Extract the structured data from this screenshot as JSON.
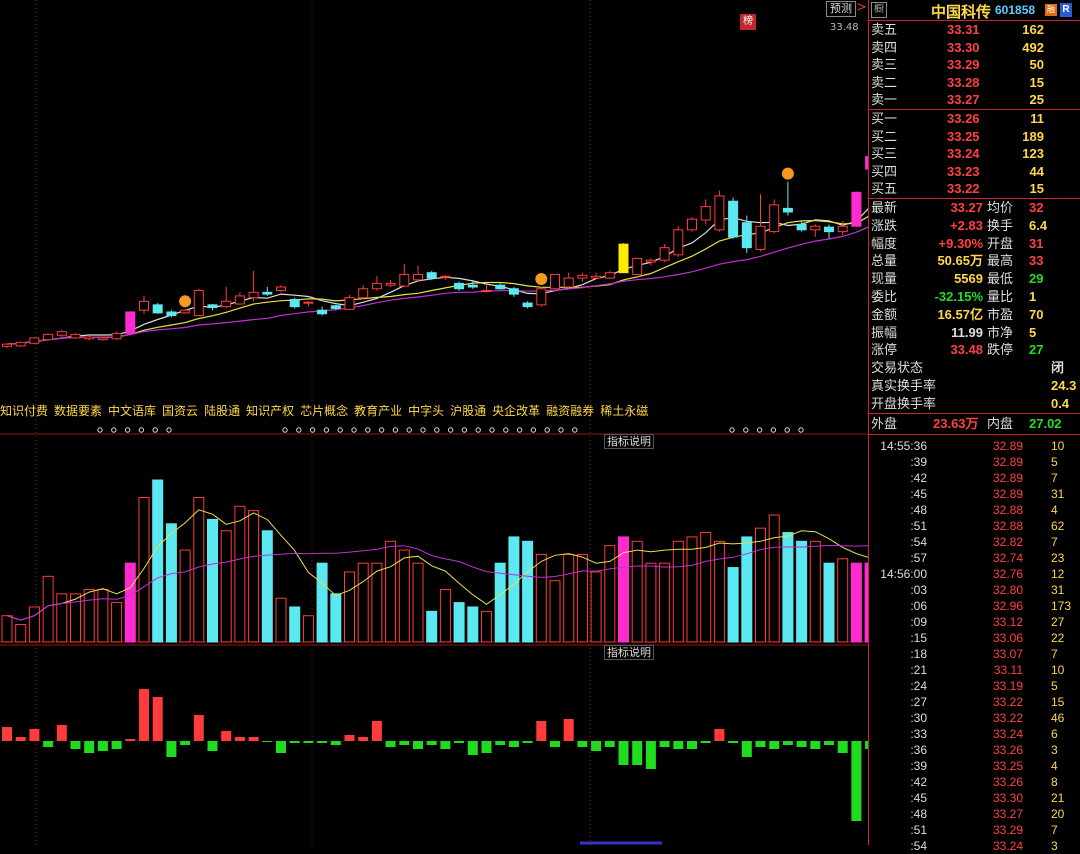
{
  "panel": {
    "stock_name": "中国科传",
    "stock_code": "601858",
    "icon_label": "橱",
    "badge_rong": "融",
    "badge_r": "R",
    "order_book": {
      "sells": [
        {
          "label": "卖五",
          "price": "33.31",
          "vol": "162"
        },
        {
          "label": "卖四",
          "price": "33.30",
          "vol": "492"
        },
        {
          "label": "卖三",
          "price": "33.29",
          "vol": "50"
        },
        {
          "label": "卖二",
          "price": "33.28",
          "vol": "15"
        },
        {
          "label": "卖一",
          "price": "33.27",
          "vol": "25"
        }
      ],
      "buys": [
        {
          "label": "买一",
          "price": "33.26",
          "vol": "11"
        },
        {
          "label": "买二",
          "price": "33.25",
          "vol": "189"
        },
        {
          "label": "买三",
          "price": "33.24",
          "vol": "123"
        },
        {
          "label": "买四",
          "price": "33.23",
          "vol": "44"
        },
        {
          "label": "买五",
          "price": "33.22",
          "vol": "15"
        }
      ]
    },
    "quote": [
      {
        "l1": "最新",
        "v1": "33.27",
        "c1": "red",
        "l2": "均价",
        "v2": "32",
        "c2": "red"
      },
      {
        "l1": "涨跌",
        "v1": "+2.83",
        "c1": "red",
        "l2": "换手",
        "v2": "6.4",
        "c2": "yel"
      },
      {
        "l1": "幅度",
        "v1": "+9.30%",
        "c1": "red",
        "l2": "开盘",
        "v2": "31",
        "c2": "red"
      },
      {
        "l1": "总量",
        "v1": "50.65万",
        "c1": "yel",
        "l2": "最高",
        "v2": "33",
        "c2": "red"
      },
      {
        "l1": "现量",
        "v1": "5569",
        "c1": "yel",
        "l2": "最低",
        "v2": "29",
        "c2": "grn"
      },
      {
        "l1": "委比",
        "v1": "-32.15%",
        "c1": "grn",
        "l2": "量比",
        "v2": "1",
        "c2": "yel"
      },
      {
        "l1": "金额",
        "v1": "16.57亿",
        "c1": "yel",
        "l2": "市盈",
        "v2": "70",
        "c2": "yel"
      },
      {
        "l1": "振幅",
        "v1": "11.99",
        "c1": "wht",
        "l2": "市净",
        "v2": "5",
        "c2": "yel"
      },
      {
        "l1": "涨停",
        "v1": "33.48",
        "c1": "red",
        "l2": "跌停",
        "v2": "27",
        "c2": "grn"
      }
    ],
    "extra": [
      {
        "label": "交易状态",
        "value": "闭",
        "c": "wht"
      },
      {
        "label": "真实换手率",
        "value": "24.3",
        "c": "yel"
      },
      {
        "label": "开盘换手率",
        "value": "0.4",
        "c": "yel"
      }
    ],
    "waipan_label": "外盘",
    "waipan": "23.63万",
    "neipan_label": "内盘",
    "neipan": "27.02",
    "ticks": [
      {
        "t": "14:55:36",
        "p": "32.89",
        "v": "10"
      },
      {
        "t": ":39",
        "p": "32.89",
        "v": "5"
      },
      {
        "t": ":42",
        "p": "32.89",
        "v": "7"
      },
      {
        "t": ":45",
        "p": "32.89",
        "v": "31"
      },
      {
        "t": ":48",
        "p": "32.88",
        "v": "4"
      },
      {
        "t": ":51",
        "p": "32.88",
        "v": "62"
      },
      {
        "t": ":54",
        "p": "32.82",
        "v": "7"
      },
      {
        "t": ":57",
        "p": "32.74",
        "v": "23"
      },
      {
        "t": "14:56:00",
        "p": "32.76",
        "v": "12"
      },
      {
        "t": ":03",
        "p": "32.80",
        "v": "31"
      },
      {
        "t": ":06",
        "p": "32.96",
        "v": "173"
      },
      {
        "t": ":09",
        "p": "33.12",
        "v": "27"
      },
      {
        "t": ":15",
        "p": "33.06",
        "v": "22"
      },
      {
        "t": ":18",
        "p": "33.07",
        "v": "7"
      },
      {
        "t": ":21",
        "p": "33.11",
        "v": "10"
      },
      {
        "t": ":24",
        "p": "33.19",
        "v": "5"
      },
      {
        "t": ":27",
        "p": "33.22",
        "v": "15"
      },
      {
        "t": ":30",
        "p": "33.22",
        "v": "46"
      },
      {
        "t": ":33",
        "p": "33.24",
        "v": "6"
      },
      {
        "t": ":36",
        "p": "33.26",
        "v": "3"
      },
      {
        "t": ":39",
        "p": "33.25",
        "v": "4"
      },
      {
        "t": ":42",
        "p": "33.26",
        "v": "8"
      },
      {
        "t": ":45",
        "p": "33.30",
        "v": "21"
      },
      {
        "t": ":48",
        "p": "33.27",
        "v": "20"
      },
      {
        "t": ":51",
        "p": "33.29",
        "v": "7"
      },
      {
        "t": ":54",
        "p": "33.24",
        "v": "3"
      }
    ]
  },
  "chart": {
    "predict_button": "预测",
    "high_label": "33.48",
    "bang_label": "榜",
    "indicator_label_1": "指标说明",
    "indicator_label_2": "指标说明",
    "concept_tags": [
      "知识付费",
      "数据要素",
      "中文语库",
      "国资云",
      "陆股通",
      "知识产权",
      "芯片概念",
      "教育产业",
      "中字头",
      "沪股通",
      "央企改革",
      "融资融券",
      "稀土永磁"
    ]
  },
  "colors": {
    "up": "#ff3b3b",
    "down": "#5ce8f0",
    "magenta": "#ff2bd0",
    "limit": "#ffea00",
    "grid": "#8b1a1a",
    "ma5": "#dddddd",
    "ma10": "#e8e04a",
    "ma20": "#c030d0"
  },
  "chart_data": {
    "type": "candlestick",
    "ylim": [
      15.2,
      33.9
    ],
    "candles": [
      [
        16.08,
        16.2,
        15.98,
        16.25
      ],
      [
        16.1,
        16.3,
        16.05,
        16.35
      ],
      [
        16.25,
        16.55,
        16.2,
        16.6
      ],
      [
        16.45,
        16.75,
        16.4,
        16.8
      ],
      [
        16.7,
        16.9,
        16.6,
        17.0
      ],
      [
        16.55,
        16.75,
        16.5,
        16.8
      ],
      [
        16.5,
        16.6,
        16.4,
        16.7
      ],
      [
        16.45,
        16.55,
        16.4,
        16.6
      ],
      [
        16.5,
        16.8,
        16.45,
        16.9
      ],
      [
        16.8,
        18.0,
        16.75,
        18.05
      ],
      [
        18.1,
        18.6,
        17.9,
        18.9
      ],
      [
        18.4,
        17.95,
        17.9,
        18.5
      ],
      [
        18.0,
        17.8,
        17.7,
        18.1
      ],
      [
        17.95,
        18.1,
        17.9,
        18.15
      ],
      [
        17.8,
        19.2,
        17.8,
        19.3
      ],
      [
        18.4,
        18.25,
        18.1,
        18.45
      ],
      [
        18.3,
        18.6,
        18.2,
        19.4
      ],
      [
        18.45,
        18.9,
        18.4,
        19.1
      ],
      [
        18.8,
        19.1,
        18.6,
        20.3
      ],
      [
        19.1,
        19.0,
        18.9,
        19.4
      ],
      [
        19.2,
        19.4,
        19.1,
        19.5
      ],
      [
        18.7,
        18.3,
        18.2,
        18.8
      ],
      [
        18.5,
        18.55,
        18.3,
        18.6
      ],
      [
        18.1,
        17.9,
        17.8,
        18.3
      ],
      [
        18.35,
        18.2,
        18.1,
        18.4
      ],
      [
        18.15,
        18.8,
        18.1,
        18.95
      ],
      [
        18.8,
        19.3,
        18.7,
        19.5
      ],
      [
        19.3,
        19.6,
        19.2,
        20.0
      ],
      [
        19.5,
        19.6,
        19.4,
        19.8
      ],
      [
        19.45,
        20.1,
        19.4,
        20.7
      ],
      [
        19.8,
        20.1,
        19.7,
        20.6
      ],
      [
        20.2,
        19.9,
        19.8,
        20.3
      ],
      [
        19.95,
        20.0,
        19.8,
        20.05
      ],
      [
        19.6,
        19.3,
        19.2,
        19.7
      ],
      [
        19.5,
        19.4,
        19.3,
        19.8
      ],
      [
        19.2,
        19.2,
        19.1,
        19.5
      ],
      [
        19.5,
        19.3,
        19.25,
        19.6
      ],
      [
        19.3,
        19.0,
        18.85,
        19.4
      ],
      [
        18.5,
        18.3,
        18.2,
        18.6
      ],
      [
        18.4,
        19.3,
        18.3,
        19.4
      ],
      [
        19.3,
        20.1,
        19.3,
        20.1
      ],
      [
        19.4,
        19.9,
        19.3,
        20.2
      ],
      [
        19.9,
        20.05,
        19.7,
        20.2
      ],
      [
        19.9,
        20.0,
        19.85,
        20.2
      ],
      [
        19.9,
        20.2,
        19.85,
        20.3
      ],
      [
        20.2,
        21.8,
        20.2,
        21.85
      ],
      [
        20.1,
        21.0,
        20.1,
        21.0
      ],
      [
        20.8,
        20.9,
        20.6,
        21.0
      ],
      [
        20.9,
        21.6,
        20.8,
        21.8
      ],
      [
        21.2,
        22.6,
        21.1,
        22.8
      ],
      [
        22.6,
        23.2,
        22.5,
        23.3
      ],
      [
        23.15,
        23.9,
        22.9,
        24.3
      ],
      [
        22.6,
        24.5,
        22.5,
        24.8
      ],
      [
        24.2,
        22.2,
        22.1,
        24.4
      ],
      [
        23.0,
        21.6,
        21.3,
        23.4
      ],
      [
        21.5,
        22.8,
        21.4,
        24.6
      ],
      [
        22.5,
        24.0,
        22.4,
        24.3
      ],
      [
        23.8,
        23.6,
        23.4,
        25.3
      ],
      [
        22.9,
        22.6,
        22.5,
        23.1
      ],
      [
        22.6,
        22.8,
        22.2,
        22.9
      ],
      [
        22.75,
        22.5,
        22.1,
        22.9
      ],
      [
        22.5,
        22.8,
        22.3,
        23.1
      ],
      [
        22.8,
        24.7,
        22.8,
        24.75
      ],
      [
        26.0,
        26.7,
        25.8,
        27.0
      ],
      [
        25.8,
        26.3,
        25.6,
        28.0
      ],
      [
        26.4,
        28.6,
        26.4,
        28.65
      ],
      [
        28.2,
        30.1,
        27.0,
        30.2
      ],
      [
        29.4,
        29.9,
        28.3,
        30.0
      ],
      [
        29.2,
        29.8,
        28.0,
        30.2
      ],
      [
        29.1,
        29.2,
        28.0,
        29.6
      ],
      [
        29.3,
        29.6,
        28.6,
        30.0
      ],
      [
        28.9,
        30.3,
        28.5,
        31.6
      ],
      [
        30.5,
        32.1,
        30.4,
        32.15
      ],
      [
        30.6,
        33.27,
        29.9,
        33.48
      ]
    ],
    "limit_up_index": [
      9,
      45,
      62,
      63,
      64,
      66,
      71,
      72
    ],
    "volume": [
      30,
      20,
      40,
      75,
      55,
      55,
      60,
      60,
      45,
      90,
      165,
      185,
      135,
      105,
      165,
      140,
      127,
      155,
      150,
      127,
      50,
      40,
      30,
      90,
      55,
      80,
      90,
      90,
      115,
      105,
      90,
      35,
      60,
      45,
      40,
      35,
      90,
      120,
      115,
      100,
      70,
      100,
      100,
      80,
      110,
      120,
      115,
      90,
      90,
      115,
      120,
      125,
      115,
      85,
      120,
      130,
      145,
      125,
      115,
      115,
      90,
      95,
      90,
      90,
      100,
      155,
      115,
      110,
      125,
      140,
      115,
      100,
      120,
      110
    ],
    "macd": [
      35,
      10,
      30,
      -15,
      40,
      -20,
      -30,
      -25,
      -20,
      5,
      130,
      110,
      -40,
      -10,
      65,
      -25,
      25,
      10,
      10,
      0,
      -30,
      -5,
      -5,
      -5,
      -10,
      15,
      10,
      50,
      -15,
      -10,
      -20,
      -10,
      -20,
      -5,
      -35,
      -30,
      -10,
      -15,
      -5,
      50,
      -15,
      55,
      -15,
      -25,
      -15,
      -60,
      -60,
      -70,
      -15,
      -20,
      -20,
      -5,
      30,
      -5,
      -40,
      -15,
      -20,
      -10,
      -15,
      -20,
      -10,
      -30,
      -200,
      -20,
      -45,
      -20,
      -20,
      -15,
      -100,
      -30,
      -40,
      -40,
      -25,
      -10
    ]
  }
}
